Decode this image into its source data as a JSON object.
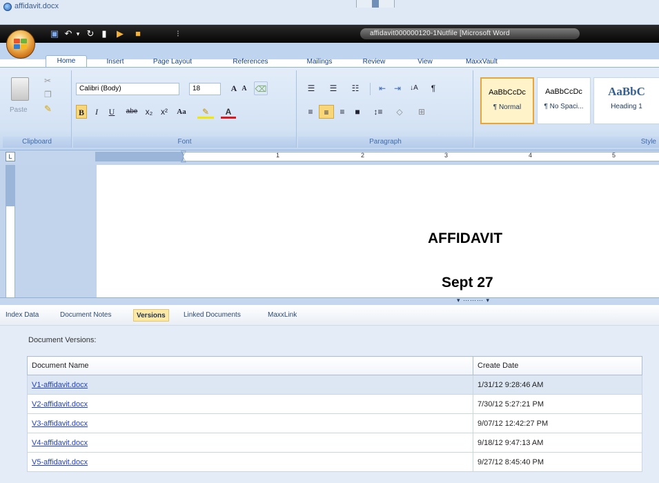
{
  "window": {
    "doc_name": "affidavit.docx"
  },
  "titlebar": {
    "title_text": "affidavit000000120-1Nutfile [Microsoft Word"
  },
  "ribbon_tabs": [
    "Home",
    "Insert",
    "Page Layout",
    "References",
    "Mailings",
    "Review",
    "View",
    "MaxxVault"
  ],
  "ribbon": {
    "clipboard": {
      "paste_label": "Paste",
      "group_label": "Clipboard"
    },
    "font": {
      "font_name": "Calibri (Body)",
      "font_size": "18",
      "group_label": "Font",
      "bold": "B",
      "italic": "I",
      "underline": "U",
      "strike": "abe",
      "subscript": "x₂",
      "superscript": "x²",
      "change_case": "Aa",
      "grow": "A",
      "shrink": "A"
    },
    "paragraph": {
      "group_label": "Paragraph"
    },
    "styles": {
      "items": [
        {
          "sample": "AaBbCcDc",
          "name": "¶ Normal"
        },
        {
          "sample": "AaBbCcDc",
          "name": "¶ No Spaci..."
        },
        {
          "sample": "AaBbC",
          "name": "Heading 1"
        }
      ],
      "group_label": "Style"
    }
  },
  "document": {
    "title": "AFFIDAVIT",
    "date": "Sept 27"
  },
  "ruler": {
    "numbers": [
      "1",
      "2",
      "3",
      "4",
      "5"
    ]
  },
  "lower_tabs": [
    "Index Data",
    "Document Notes",
    "Versions",
    "Linked Documents",
    "MaxxLink"
  ],
  "versions": {
    "heading": "Document Versions:",
    "columns": [
      "Document Name",
      "Create Date"
    ],
    "rows": [
      {
        "name": "V1-affidavit.docx",
        "date": "1/31/12 9:28:46 AM"
      },
      {
        "name": "V2-affidavit.docx",
        "date": "7/30/12 5:27:21 PM"
      },
      {
        "name": "V3-affidavit.docx",
        "date": "9/07/12 12:42:27 PM"
      },
      {
        "name": "V4-affidavit.docx",
        "date": "9/18/12 9:47:13 AM"
      },
      {
        "name": "V5-affidavit.docx",
        "date": "9/27/12 8:45:40 PM"
      }
    ]
  }
}
